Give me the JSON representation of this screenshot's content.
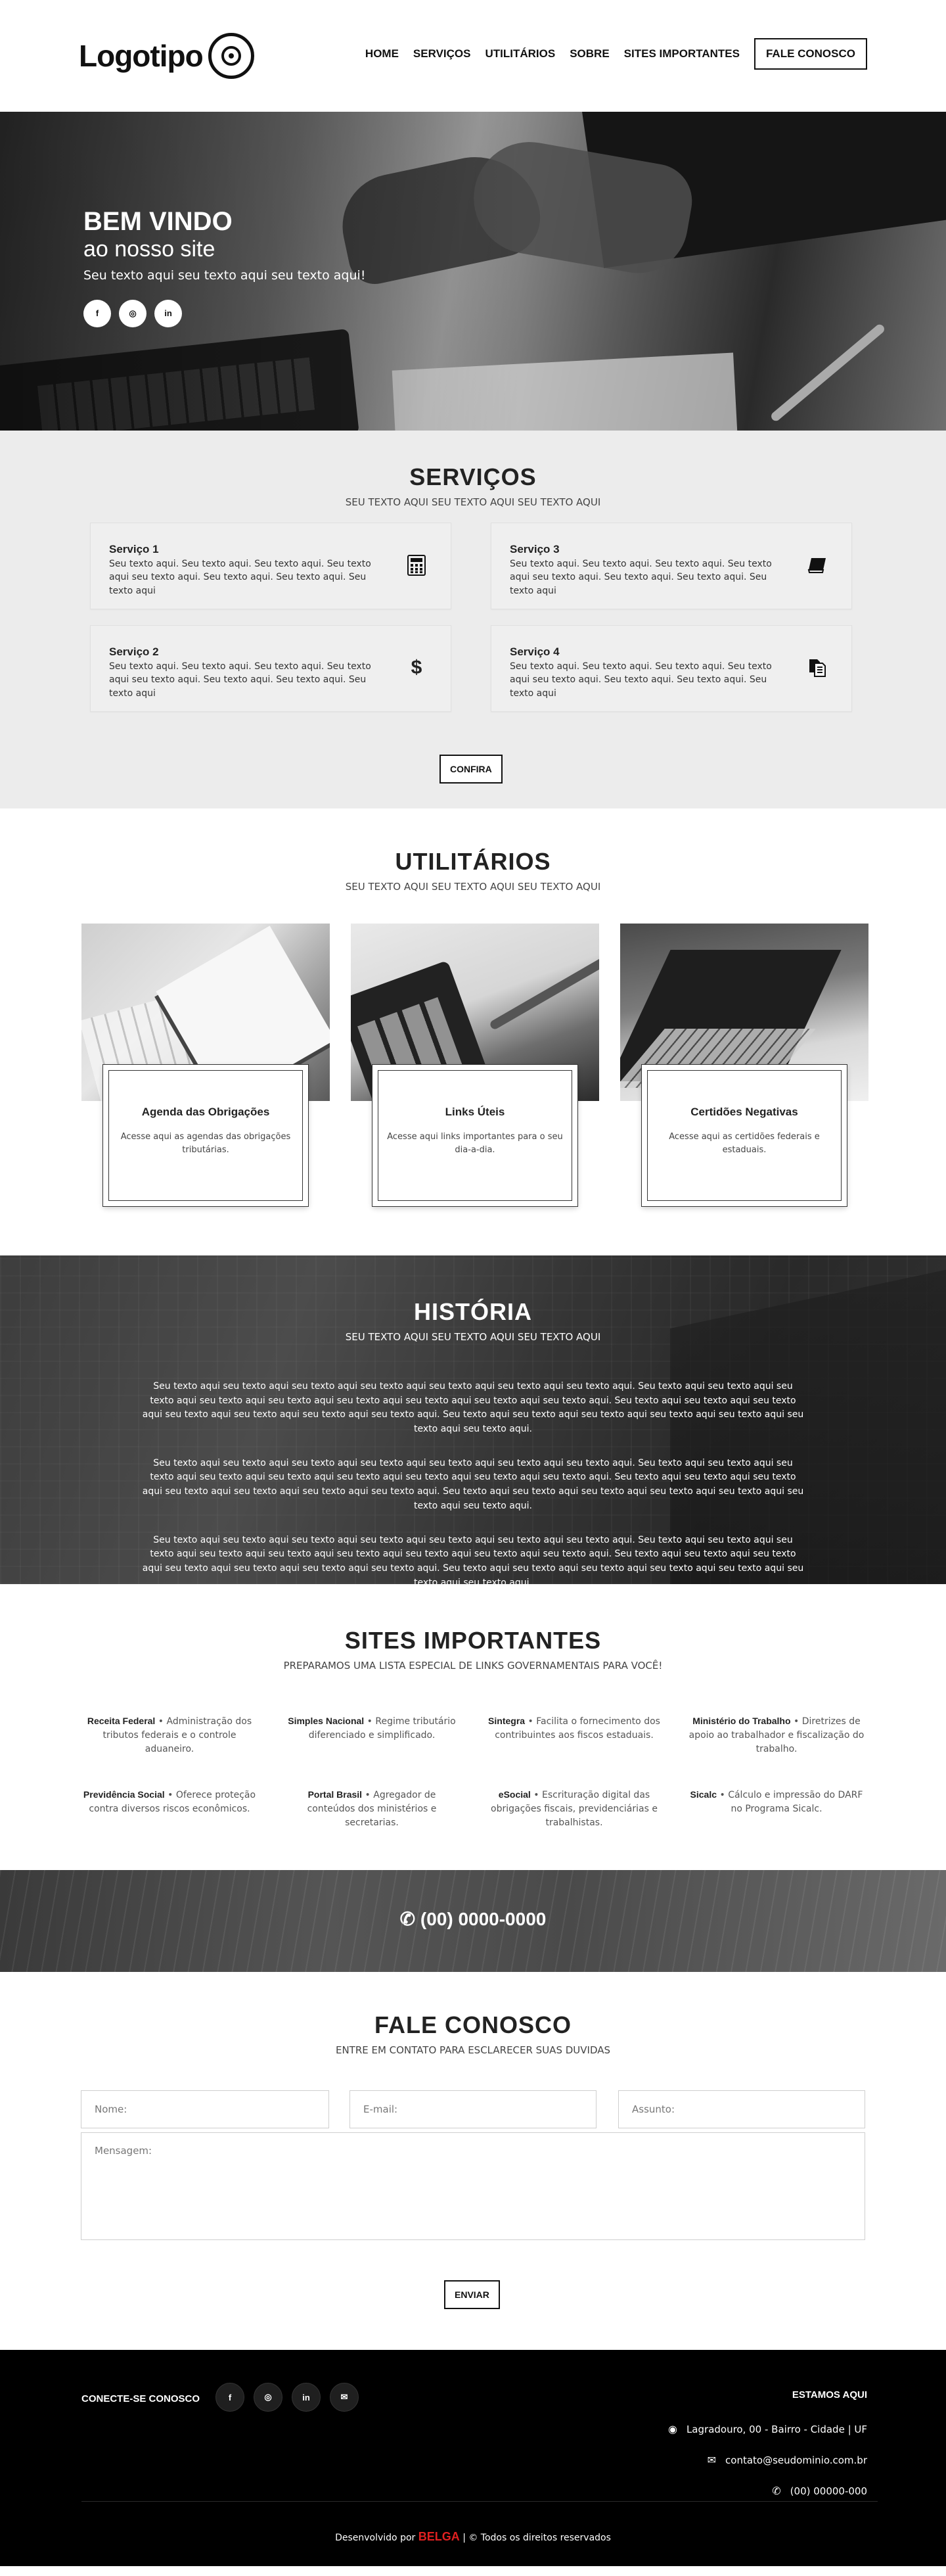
{
  "header": {
    "logo_text": "Logotipo",
    "nav": [
      "HOME",
      "SERVIÇOS",
      "UTILITÁRIOS",
      "SOBRE",
      "SITES IMPORTANTES",
      "FALE CONOSCO"
    ]
  },
  "hero": {
    "title": "BEM VINDO",
    "subtitle": "ao nosso site",
    "text": "Seu texto aqui seu texto aqui seu texto aqui!",
    "social": [
      "f",
      "◎",
      "in"
    ]
  },
  "servicos": {
    "title": "SERVIÇOS",
    "subtitle": "SEU TEXTO AQUI SEU TEXTO AQUI SEU TEXTO AQUI",
    "items": [
      {
        "title": "Serviço 1",
        "text": "Seu texto aqui. Seu texto aqui. Seu texto aqui. Seu texto aqui seu texto aqui. Seu texto aqui. Seu texto aqui. Seu texto aqui",
        "icon": "calculator-icon"
      },
      {
        "title": "Serviço 3",
        "text": "Seu texto aqui. Seu texto aqui. Seu texto aqui. Seu texto aqui seu texto aqui. Seu texto aqui. Seu texto aqui. Seu texto aqui",
        "icon": "book-icon"
      },
      {
        "title": "Serviço 2",
        "text": "Seu texto aqui. Seu texto aqui. Seu texto aqui. Seu texto aqui seu texto aqui. Seu texto aqui. Seu texto aqui. Seu texto aqui",
        "icon": "dollar-icon"
      },
      {
        "title": "Serviço 4",
        "text": "Seu texto aqui. Seu texto aqui. Seu texto aqui. Seu texto aqui seu texto aqui. Seu texto aqui. Seu texto aqui. Seu texto aqui",
        "icon": "documents-icon"
      }
    ],
    "button": "CONFIRA"
  },
  "utilitarios": {
    "title": "UTILITÁRIOS",
    "subtitle": "SEU TEXTO AQUI SEU TEXTO AQUI SEU TEXTO AQUI",
    "items": [
      {
        "title": "Agenda das Obrigações",
        "text": "Acesse aqui as agendas das obrigações tributárias."
      },
      {
        "title": "Links Úteis",
        "text": "Acesse aqui links importantes para o seu dia-a-dia."
      },
      {
        "title": "Certidões Negativas",
        "text": "Acesse aqui as certidões federais e estaduais."
      }
    ]
  },
  "historia": {
    "title": "HISTÓRIA",
    "subtitle": "SEU TEXTO AQUI SEU TEXTO AQUI SEU TEXTO AQUI",
    "paragraphs": [
      "Seu texto aqui seu texto aqui seu texto aqui seu texto aqui seu texto aqui seu texto aqui seu texto aqui. Seu texto aqui seu texto aqui seu texto aqui seu texto aqui seu texto aqui seu texto aqui seu texto aqui seu texto aqui seu texto aqui. Seu texto aqui seu texto aqui seu texto aqui seu texto aqui seu texto aqui seu texto aqui seu texto aqui. Seu texto aqui seu texto aqui seu texto aqui seu texto aqui seu texto aqui seu texto aqui seu texto aqui.",
      "Seu texto aqui seu texto aqui seu texto aqui seu texto aqui seu texto aqui seu texto aqui seu texto aqui. Seu texto aqui seu texto aqui seu texto aqui seu texto aqui seu texto aqui seu texto aqui seu texto aqui seu texto aqui seu texto aqui. Seu texto aqui seu texto aqui seu texto aqui seu texto aqui seu texto aqui seu texto aqui seu texto aqui. Seu texto aqui seu texto aqui seu texto aqui seu texto aqui seu texto aqui seu texto aqui seu texto aqui.",
      "Seu texto aqui seu texto aqui seu texto aqui seu texto aqui seu texto aqui seu texto aqui seu texto aqui. Seu texto aqui seu texto aqui seu texto aqui seu texto aqui seu texto aqui seu texto aqui seu texto aqui seu texto aqui seu texto aqui. Seu texto aqui seu texto aqui seu texto aqui seu texto aqui seu texto aqui seu texto aqui seu texto aqui. Seu texto aqui seu texto aqui seu texto aqui seu texto aqui seu texto aqui seu texto aqui seu texto aqui."
    ]
  },
  "sites": {
    "title": "SITES IMPORTANTES",
    "subtitle": "PREPARAMOS UMA LISTA ESPECIAL DE LINKS GOVERNAMENTAIS PARA VOCÊ!",
    "items": [
      {
        "name": "Receita Federal",
        "desc": "Administração dos tributos federais e o controle aduaneiro."
      },
      {
        "name": "Simples Nacional",
        "desc": "Regime tributário diferenciado e simplificado."
      },
      {
        "name": "Sintegra",
        "desc": "Facilita o fornecimento dos contribuintes aos fiscos estaduais."
      },
      {
        "name": "Ministério do Trabalho",
        "desc": "Diretrizes de apoio ao trabalhador e fiscalização do trabalho."
      },
      {
        "name": "Previdência Social",
        "desc": "Oferece proteção contra diversos riscos econômicos."
      },
      {
        "name": "Portal Brasil",
        "desc": "Agregador de conteúdos dos ministérios e secretarias."
      },
      {
        "name": "eSocial",
        "desc": "Escrituração digital das obrigações fiscais, previdenciárias e trabalhistas."
      },
      {
        "name": "Sicalc",
        "desc": "Cálculo e impressão do DARF no Programa Sicalc."
      }
    ]
  },
  "phone_strip": {
    "text": "(00) 0000-0000",
    "icon": "phone-icon"
  },
  "contato": {
    "title": "FALE CONOSCO",
    "subtitle": "ENTRE EM CONTATO PARA ESCLARECER SUAS DUVIDAS",
    "placeholders": {
      "name": "Nome:",
      "email": "E-mail:",
      "subject": "Assunto:",
      "message": "Mensagem:"
    },
    "button": "ENVIAR"
  },
  "footer": {
    "connect": "CONECTE-SE CONOSCO",
    "social": [
      "f",
      "◎",
      "in",
      "✉"
    ],
    "right_title": "ESTAMOS AQUI",
    "address": "Lagradouro, 00 - Bairro - Cidade | UF",
    "email": "contato@seudominio.com.br",
    "phone": "(00) 00000-000",
    "credit_prefix": "Desenvolvido por",
    "brand": "BELGA",
    "credit_suffix": "| © Todos os direitos reservados"
  }
}
